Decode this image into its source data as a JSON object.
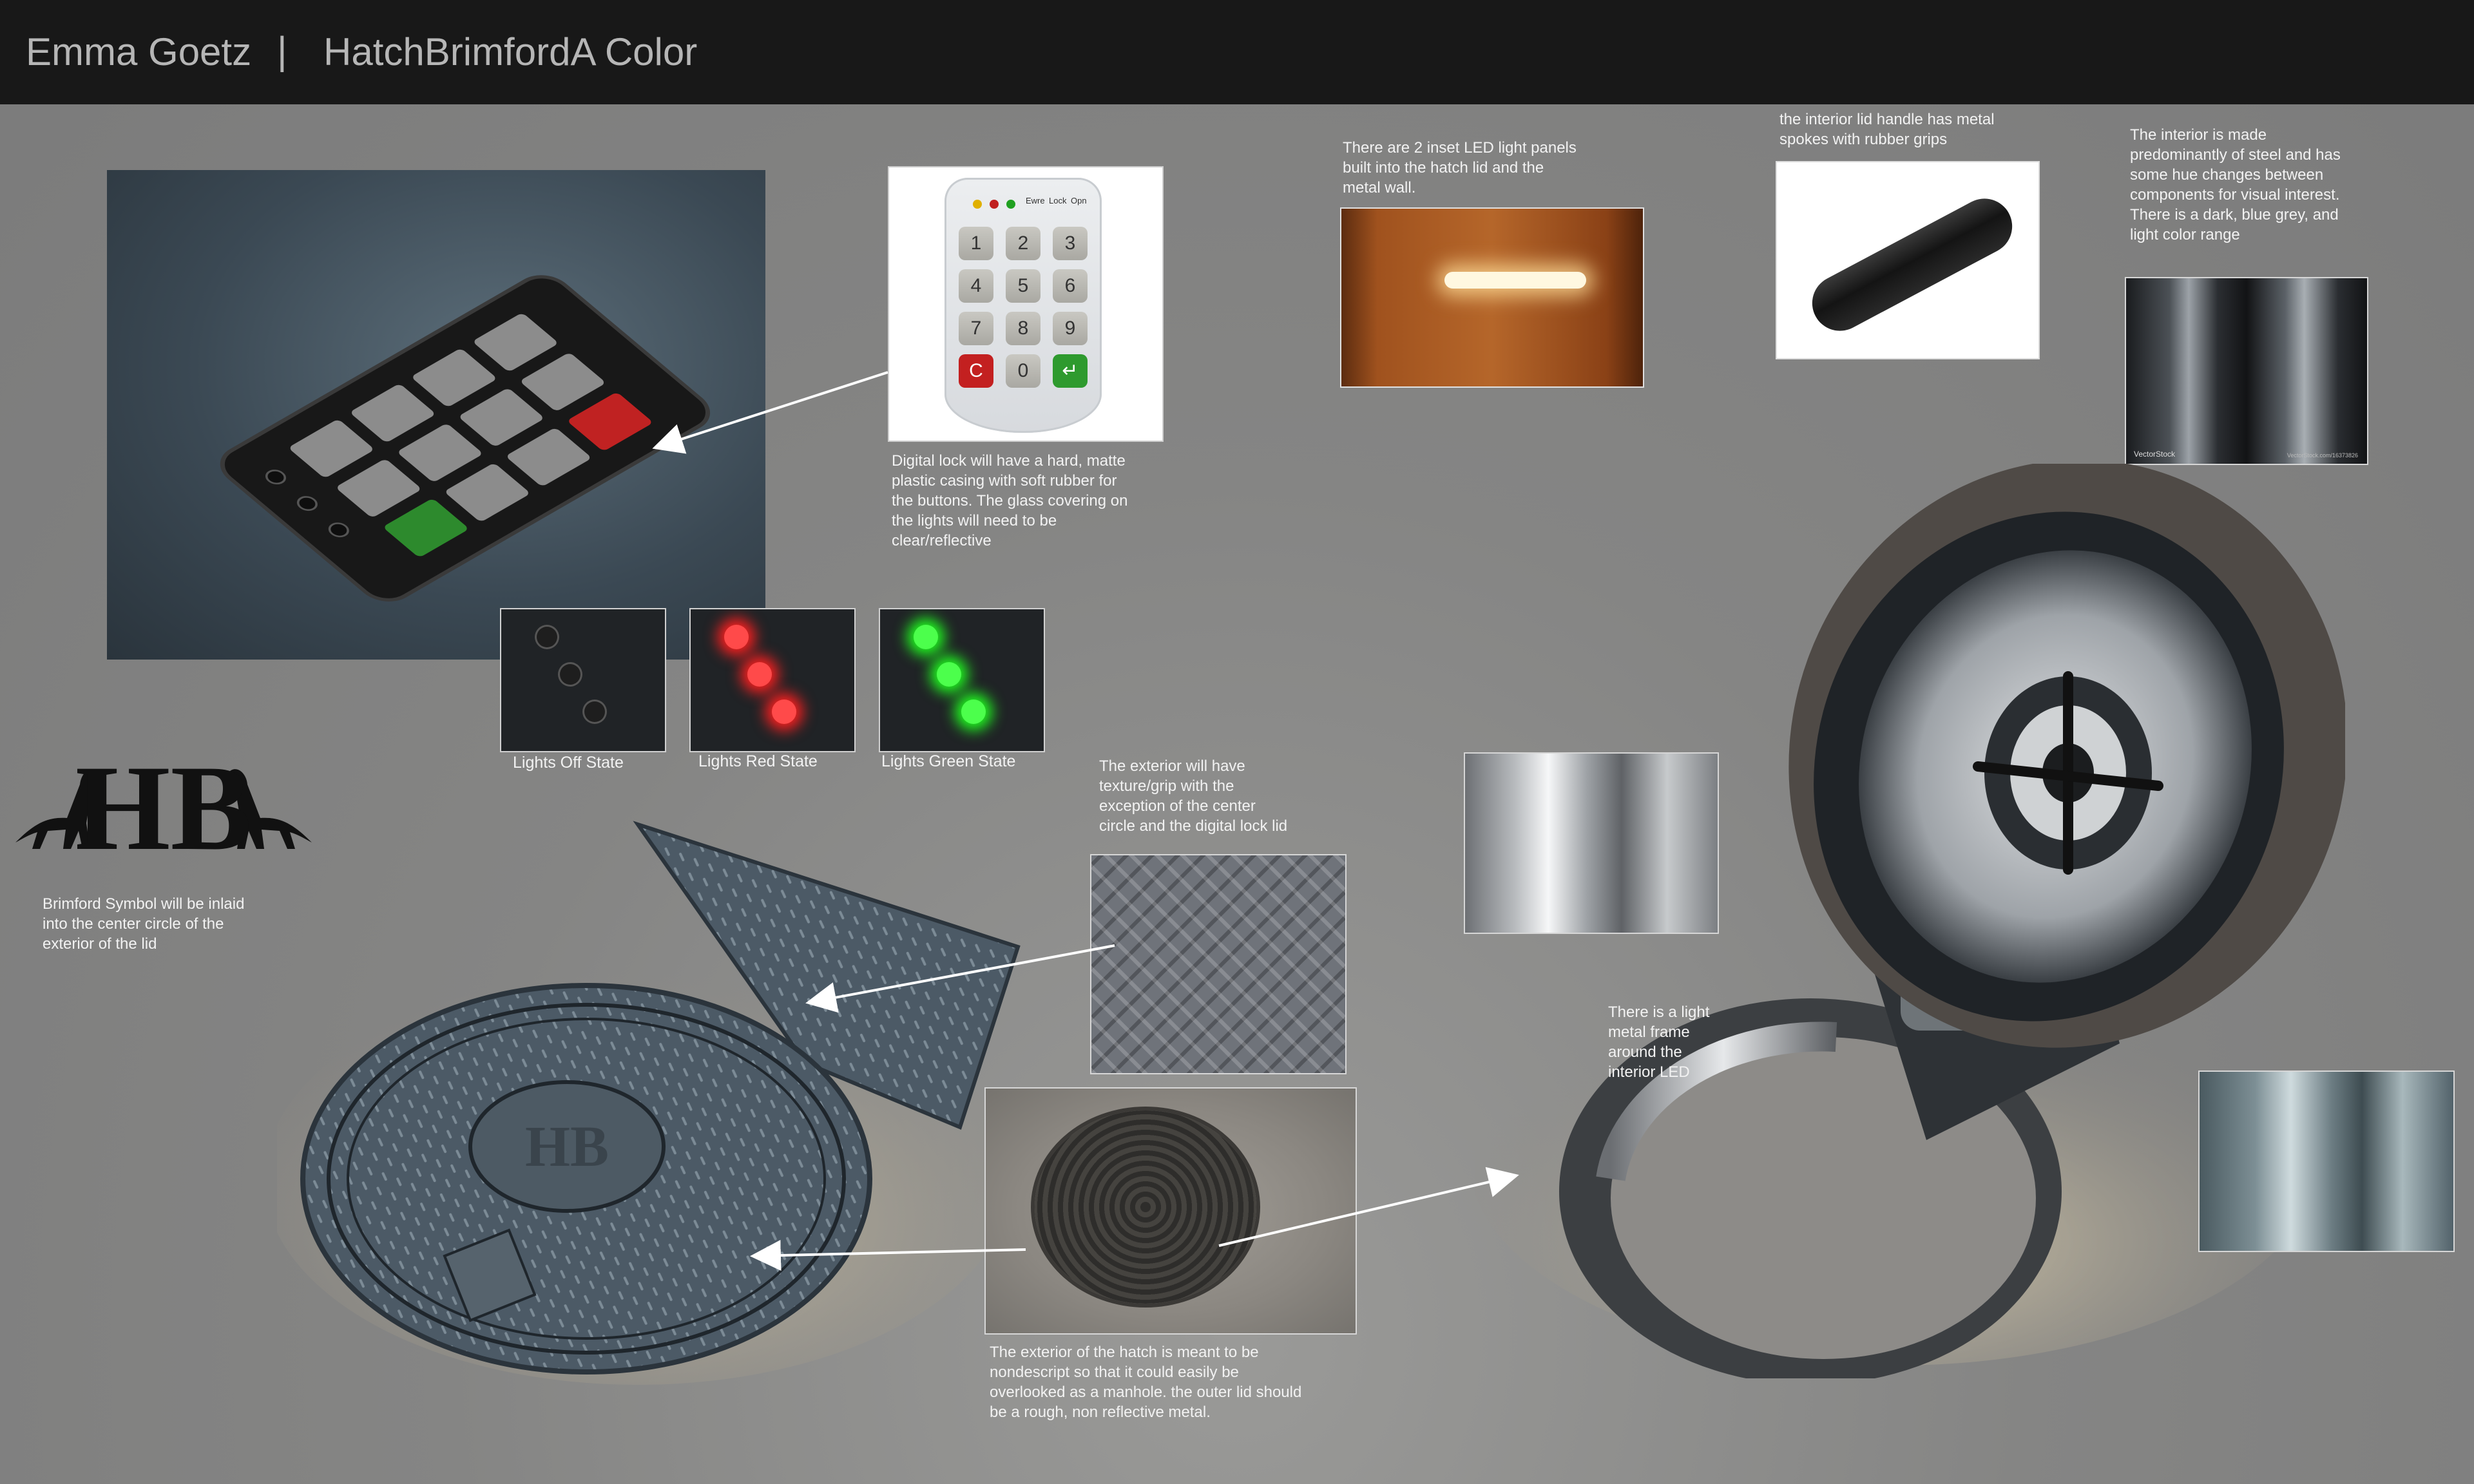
{
  "header": {
    "author": "Emma Goetz",
    "separator": "|",
    "title": "HatchBrimfordA Color"
  },
  "notes": {
    "digital_lock": "Digital lock will have a hard, matte\nplastic casing with soft rubber for\nthe buttons. The glass covering on\nthe lights will need to be\nclear/reflective",
    "led_panels": "There are 2 inset LED light panels\nbuilt into the hatch lid and the\nmetal wall.",
    "lid_handle": "the interior lid handle has metal\nspokes with rubber grips",
    "interior_steel": "The interior is made\npredominantly of steel and has\nsome hue changes between\ncomponents for visual interest.\nThere is a dark, blue grey, and\nlight color range",
    "exterior_texture": "The exterior will have\ntexture/grip with the\nexception of the center\ncircle and the digital lock lid",
    "brimford_symbol": "Brimford Symbol will be inlaid\ninto the center circle of the\nexterior of the lid",
    "led_frame": "There is a light\nmetal frame\naround the\ninterior LED",
    "exterior_hatch": "The exterior of the hatch is meant to be\nnondescript so that it could easily be\noverlooked as a manhole. the outer lid should\nbe a rough, non reflective metal."
  },
  "light_states": [
    {
      "label": "Lights Off State",
      "led_color": "#1e1e1e",
      "glow": ""
    },
    {
      "label": "Lights Red State",
      "led_color": "#ff4a4a",
      "glow": "#ff2020"
    },
    {
      "label": "Lights Green State",
      "led_color": "#4cff4c",
      "glow": "#20ff20"
    }
  ],
  "keypad": {
    "keys": [
      "1",
      "2",
      "3",
      "4",
      "5",
      "6",
      "7",
      "8",
      "9",
      "C",
      "0",
      "↵"
    ],
    "indicator_labels": [
      "Ewre",
      "Lock",
      "Opn"
    ],
    "cancel_color": "#c32020",
    "enter_color": "#2e9a2e"
  },
  "logo": {
    "text": "HB"
  },
  "reference_images": {
    "vectorstock_brand": "VectorStock",
    "vectorstock_id": "VectorStock.com/16373826"
  },
  "colors": {
    "header_bg": "#181818",
    "header_text": "#b6b6b6",
    "background": "#7f7f7e",
    "note_text": "#f2f2f2"
  }
}
